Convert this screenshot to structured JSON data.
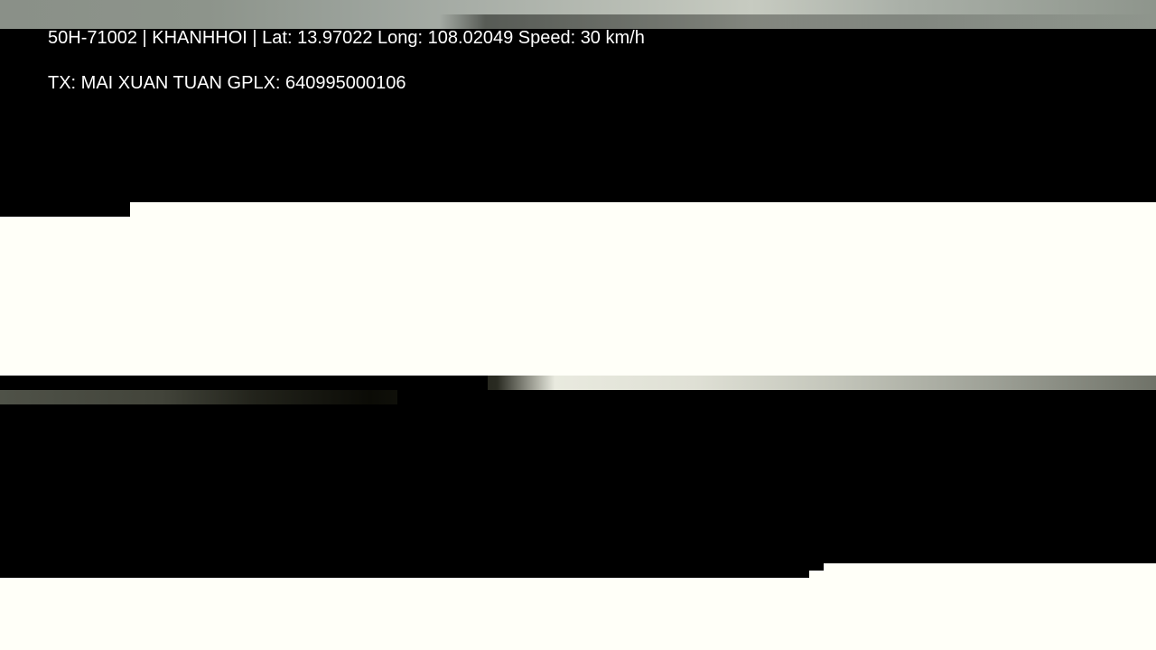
{
  "overlay": {
    "line_1": "50H-71002 | KHANHHOI | Lat: 13.97022 Long: 108.02049 Speed: 30 km/h",
    "line_2": "TX: MAI XUAN TUAN GPLX: 640995000106"
  },
  "colors": {
    "text": "#ffffff",
    "background": "#000000",
    "overexposed_band": "#fffff8"
  }
}
